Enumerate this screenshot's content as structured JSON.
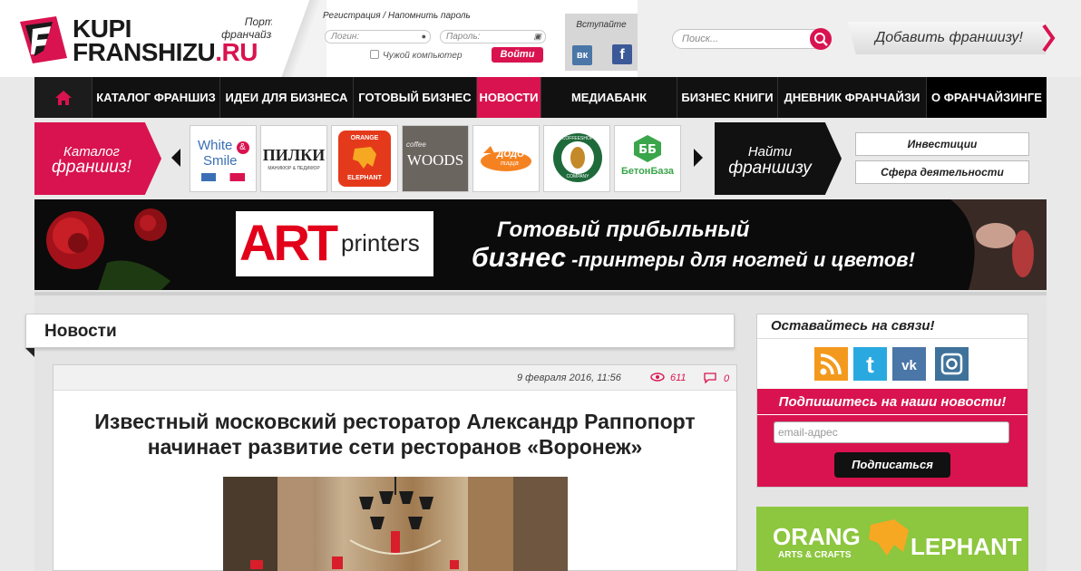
{
  "header": {
    "logo_line1": "KUPI",
    "logo_line2_prefix": "FRANSHIZU",
    "logo_line2_suffix": ".RU",
    "tagline": "Портал о франчайзинге",
    "register_link": "Регистрация",
    "link_separator": " / ",
    "remind_link": "Напомнить пароль",
    "login_placeholder": "Логин:",
    "password_placeholder": "Пароль:",
    "foreign_computer": "Чужой компьютер",
    "login_button": "Войти",
    "join_label": "Вступайте",
    "join_vk": "вк",
    "join_fb": "f",
    "search_placeholder": "Поиск...",
    "add_franchise": "Добавить франшизу!"
  },
  "nav": {
    "items": [
      {
        "label": "КАТАЛОГ ФРАНШИЗ",
        "active": false
      },
      {
        "label": "ИДЕИ ДЛЯ БИЗНЕСА",
        "active": false
      },
      {
        "label": "ГОТОВЫЙ БИЗНЕС",
        "active": false
      },
      {
        "label": "НОВОСТИ",
        "active": true
      },
      {
        "label": "МЕДИАБАНК",
        "active": false
      },
      {
        "label": "БИЗНЕС КНИГИ",
        "active": false
      },
      {
        "label": "ДНЕВНИК ФРАНЧАЙЗИ",
        "active": false
      },
      {
        "label": "О ФРАНЧАЙЗИНГЕ",
        "active": false
      }
    ]
  },
  "catalog": {
    "title_line1": "Каталог",
    "title_line2": "франшиз!",
    "brands": [
      "White & Smile",
      "ПИЛКИ",
      "Orange Elephant",
      "Coffee Woods",
      "Додо Пицца",
      "Coffeeshop Company",
      "БетонБаза"
    ],
    "brand_texts": {
      "white_smile_1": "White",
      "white_smile_and": "&",
      "white_smile_2": "Smile",
      "pilki": "ПИЛКИ",
      "pilki_sub": "МАНИКЮР & ПЕДИКЮР",
      "orange_top": "ORANGE",
      "orange_bottom": "ELEPHANT",
      "coffee_top": "coffee",
      "coffee_woods": "WOODS",
      "dodo": "ДОДО",
      "dodo_sub": "пицца",
      "coffeeshop": "COFFEESHOP",
      "company": "COMPANY",
      "betonbaza": "БетонБаза"
    },
    "find_line1": "Найти",
    "find_line2": "франшизу",
    "filter_investments": "Инвестиции",
    "filter_sphere": "Сфера деятельности"
  },
  "banner": {
    "brand_big": "ART",
    "brand_small": "printers",
    "line1": "Готовый прибыльный",
    "line2_big": "бизнес",
    "line2_small": " -принтеры для ногтей и цветов!"
  },
  "news": {
    "section_title": "Новости",
    "date": "9 февраля 2016, 11:56",
    "views": "611",
    "comments": "0",
    "headline": "Известный московский ресторатор Александр Раппопорт начинает развитие сети ресторанов «Воронеж»"
  },
  "sidebar": {
    "stay_connected": "Оставайтесь на связи!",
    "social_icons": [
      "rss-icon",
      "twitter-icon",
      "vk-icon",
      "instagram-icon"
    ],
    "subscribe_title": "Подпишитесь на наши новости!",
    "email_placeholder": "email-адрес",
    "subscribe_button": "Подписаться",
    "ad_text1": "ORANG",
    "ad_sub": "ARTS & CRAFTS",
    "ad_text2": "LEPHANT"
  },
  "colors": {
    "accent": "#d9134f",
    "dark": "#111111"
  }
}
